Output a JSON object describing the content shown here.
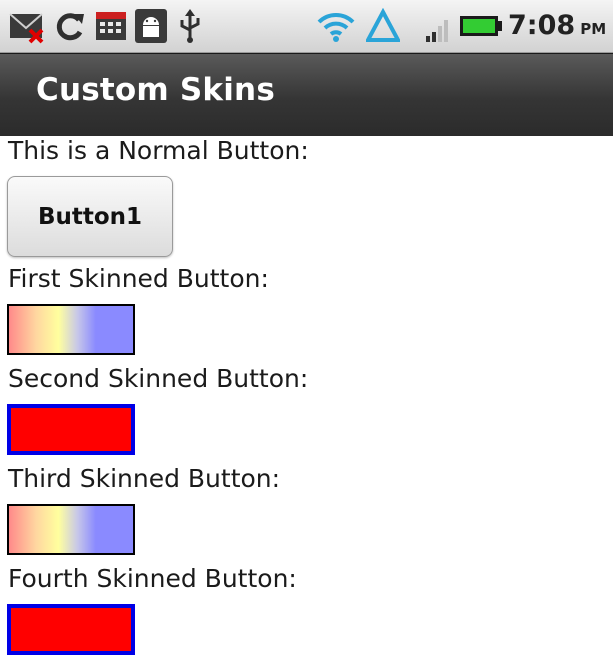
{
  "status_bar": {
    "time": "7:08",
    "ampm": "PM",
    "icons": [
      "email-error-icon",
      "sync-icon",
      "calendar-icon",
      "android-debug-icon",
      "usb-icon",
      "wifi-icon",
      "triangle-icon",
      "signal-icon",
      "battery-icon"
    ]
  },
  "app": {
    "title": "Custom Skins"
  },
  "labels": {
    "normal": "This is a Normal Button:",
    "first": "First Skinned Button:",
    "second": "Second Skinned Button:",
    "third": "Third Skinned Button:",
    "fourth": "Fourth Skinned Button:"
  },
  "buttons": {
    "normal_label": "Button1"
  },
  "colors": {
    "skin_red_fill": "#ff0000",
    "skin_red_border": "#0000e6",
    "gradient": [
      "#ff8a8a",
      "#ffff9e",
      "#8a8aff"
    ]
  }
}
